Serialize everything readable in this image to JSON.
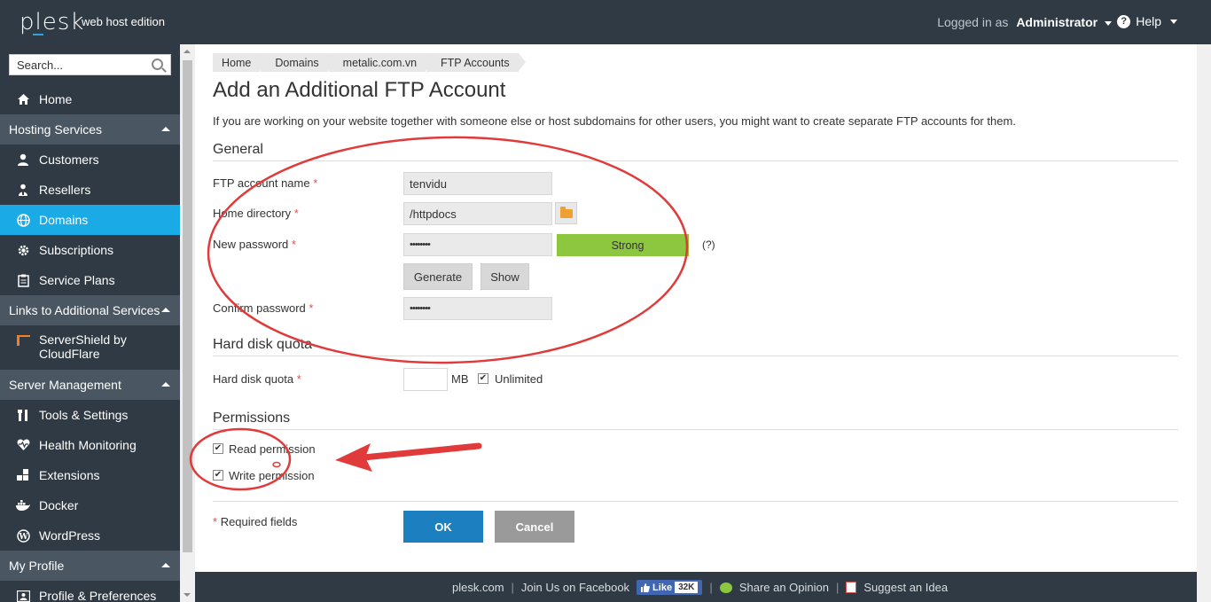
{
  "app": {
    "brand": "plesk",
    "edition": "web host edition"
  },
  "header": {
    "logged_in_as": "Logged in as",
    "user": "Administrator",
    "help": "Help"
  },
  "search": {
    "placeholder": "Search..."
  },
  "sidebar": {
    "home": "Home",
    "hosting_services": {
      "label": "Hosting Services",
      "items": [
        "Customers",
        "Resellers",
        "Domains",
        "Subscriptions",
        "Service Plans"
      ]
    },
    "links_section": {
      "label": "Links to Additional Services",
      "items": [
        "ServerShield by",
        "CloudFlare"
      ]
    },
    "server_management": {
      "label": "Server Management",
      "items": [
        "Tools & Settings",
        "Health Monitoring",
        "Extensions",
        "Docker",
        "WordPress"
      ]
    },
    "my_profile": {
      "label": "My Profile",
      "items": [
        "Profile & Preferences"
      ]
    }
  },
  "breadcrumb": [
    "Home",
    "Domains",
    "metalic.com.vn",
    "FTP Accounts"
  ],
  "page": {
    "title": "Add an Additional FTP Account",
    "intro": "If you are working on your website together with someone else or host subdomains for other users, you might want to create separate FTP accounts for them."
  },
  "general": {
    "title": "General",
    "ftp_account_name_label": "FTP account name",
    "ftp_account_name_value": "tenvidu",
    "home_directory_label": "Home directory",
    "home_directory_value": "/httpdocs",
    "new_password_label": "New password",
    "new_password_value": "••••••••",
    "password_strength": "Strong",
    "password_strength_level": 0.93,
    "help_marker": "(?)",
    "generate_label": "Generate",
    "show_label": "Show",
    "confirm_password_label": "Confirm password",
    "confirm_password_value": "••••••••",
    "required_marker": "*"
  },
  "quota": {
    "title": "Hard disk quota",
    "label": "Hard disk quota",
    "unit": "MB",
    "unlimited_label": "Unlimited",
    "unlimited_checked": "✔"
  },
  "permissions": {
    "title": "Permissions",
    "read_label": "Read permission",
    "read_checked": "✔",
    "write_label": "Write permission",
    "write_checked": "✔"
  },
  "form": {
    "required_fields": "Required fields",
    "ok_label": "OK",
    "cancel_label": "Cancel"
  },
  "footer": {
    "plesk_link": "plesk.com",
    "facebook": "Join Us on Facebook",
    "like": "Like",
    "like_count": "32K",
    "opinion": "Share an Opinion",
    "idea": "Suggest an Idea",
    "separator": "|"
  },
  "colors": {
    "topbar": "#2f3a44",
    "active_nav": "#1aaae5",
    "section_header": "#4a5662",
    "strength_fill": "#8dc63f",
    "ok_button": "#1b7fc0",
    "annotation": "#e03a3a"
  }
}
